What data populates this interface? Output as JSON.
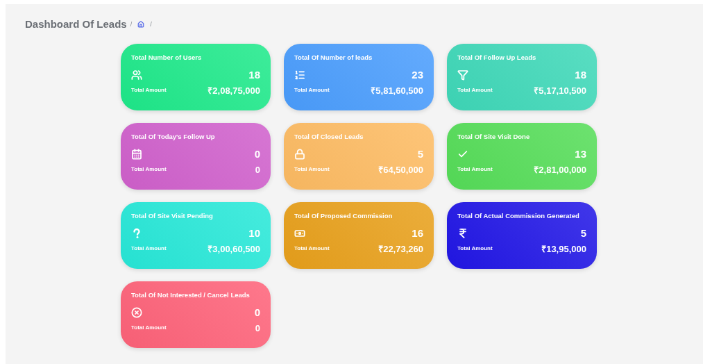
{
  "header": {
    "title": "Dashboard Of Leads",
    "separators": [
      "/",
      "/"
    ]
  },
  "cards": [
    {
      "title": "Total Number of Users",
      "count": "18",
      "amount_label": "Total Amount",
      "amount": "₹2,08,75,000",
      "color": "#1ee98a"
    },
    {
      "title": "Total Of Number of leads",
      "count": "23",
      "amount_label": "Total Amount",
      "amount": "₹5,81,60,500",
      "color": "#4a9dfd"
    },
    {
      "title": "Total Of Follow Up Leads",
      "count": "18",
      "amount_label": "Total Amount",
      "amount": "₹5,17,10,500",
      "color": "#3ed8b8"
    },
    {
      "title": "Total Of Today's Follow Up",
      "count": "0",
      "amount_label": "Total Amount",
      "amount": "0",
      "color": "#d060cc"
    },
    {
      "title": "Total Of Closed Leads",
      "count": "5",
      "amount_label": "Total Amount",
      "amount": "₹64,50,000",
      "color": "#fdbb62"
    },
    {
      "title": "Total Of Site Visit Done",
      "count": "13",
      "amount_label": "Total Amount",
      "amount": "₹2,81,00,000",
      "color": "#55dd58"
    },
    {
      "title": "Total Of Site Visit Pending",
      "count": "10",
      "amount_label": "Total Amount",
      "amount": "₹3,00,60,500",
      "color": "#27e8d8"
    },
    {
      "title": "Total Of Proposed Commission",
      "count": "16",
      "amount_label": "Total Amount",
      "amount": "₹22,73,260",
      "color": "#e8a01b"
    },
    {
      "title": "Total Of Actual Commission Generated",
      "count": "5",
      "amount_label": "Total Amount",
      "amount": "₹13,95,000",
      "color": "#2116e6"
    },
    {
      "title": "Total Of Not Interested / Cancel Leads",
      "count": "0",
      "amount_label": "Total Amount",
      "amount": "0",
      "color": "#fe6279"
    }
  ]
}
